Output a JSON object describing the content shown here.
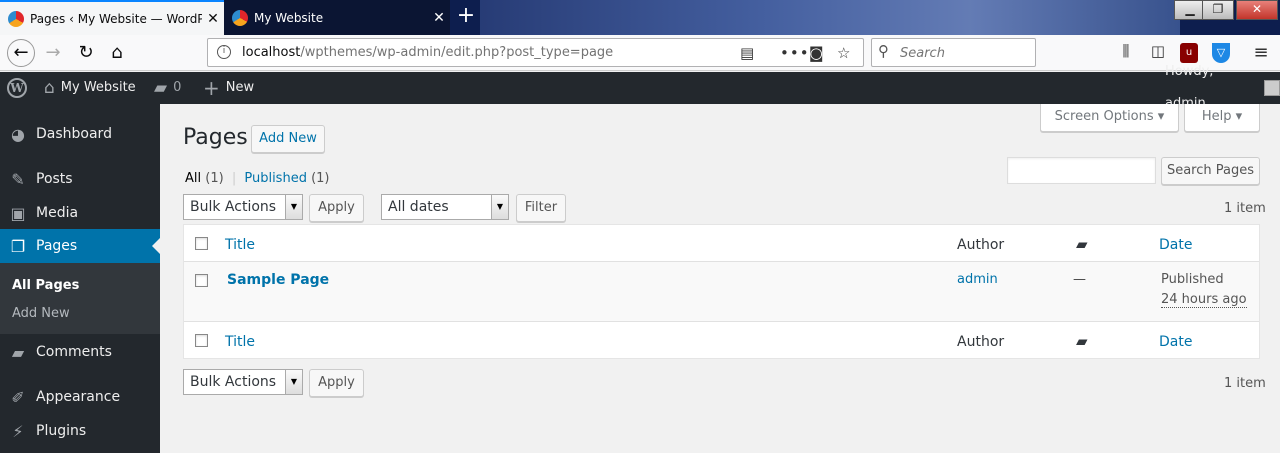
{
  "browser": {
    "tabs": [
      {
        "title": "Pages ‹ My Website — WordPre",
        "active": true
      },
      {
        "title": "My Website",
        "active": false
      }
    ],
    "url_host": "localhost",
    "url_path": "/wpthemes/wp-admin/edit.php?post_type=page",
    "search_placeholder": "Search",
    "accent": "#0a84ff"
  },
  "adminbar": {
    "site_name": "My Website",
    "comments_count": "0",
    "new_label": "New",
    "howdy": "Howdy, admin"
  },
  "sidebar": {
    "items": [
      {
        "label": "Dashboard",
        "icon": "dashboard-icon"
      },
      {
        "label": "Posts",
        "icon": "pin-icon"
      },
      {
        "label": "Media",
        "icon": "media-icon"
      },
      {
        "label": "Pages",
        "icon": "pages-icon",
        "active": true
      },
      {
        "label": "Comments",
        "icon": "comment-icon"
      },
      {
        "label": "Appearance",
        "icon": "brush-icon"
      },
      {
        "label": "Plugins",
        "icon": "plug-icon"
      }
    ],
    "submenu": [
      "All Pages",
      "Add New"
    ],
    "active_color": "#0073aa"
  },
  "content": {
    "title": "Pages",
    "add_new": "Add New",
    "screen_options": "Screen Options",
    "help": "Help",
    "filters": {
      "all": "All",
      "all_count": "(1)",
      "separator": "|",
      "published": "Published",
      "published_count": "(1)"
    },
    "search_button": "Search Pages",
    "bulk_actions": "Bulk Actions",
    "apply": "Apply",
    "all_dates": "All dates",
    "filter": "Filter",
    "item_count": "1 item",
    "columns": {
      "title": "Title",
      "author": "Author",
      "date": "Date"
    },
    "rows": [
      {
        "title": "Sample Page",
        "author": "admin",
        "comments": "—",
        "status": "Published",
        "when": "24 hours ago"
      }
    ]
  }
}
